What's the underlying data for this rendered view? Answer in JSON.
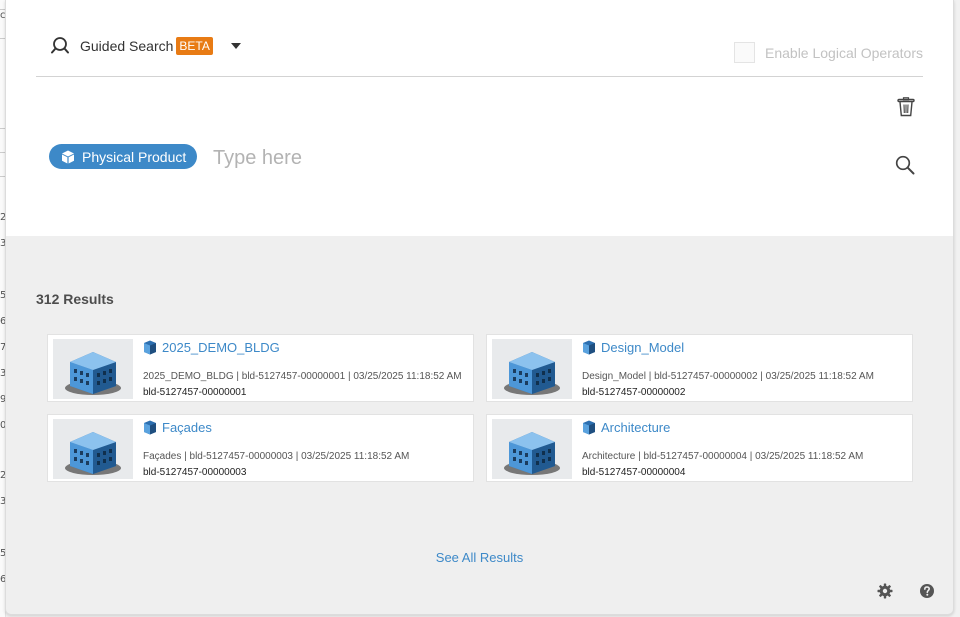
{
  "header": {
    "guided_search_label": "Guided Search",
    "beta_badge": "BETA",
    "logical_operators_label": "Enable Logical Operators"
  },
  "search": {
    "chip_label": "Physical Product",
    "placeholder": "Type here"
  },
  "results": {
    "count_label": "312 Results",
    "items": [
      {
        "title": "2025_DEMO_BLDG",
        "desc": "2025_DEMO_BLDG | bld-5127457-00000001 | 03/25/2025 11:18:52 AM",
        "id": "bld-5127457-00000001"
      },
      {
        "title": "Design_Model",
        "desc": "Design_Model | bld-5127457-00000002 | 03/25/2025 11:18:52 AM",
        "id": "bld-5127457-00000002"
      },
      {
        "title": "Façades",
        "desc": "Façades | bld-5127457-00000003 | 03/25/2025 11:18:52 AM",
        "id": "bld-5127457-00000003"
      },
      {
        "title": "Architecture",
        "desc": "Architecture | bld-5127457-00000004 | 03/25/2025 11:18:52 AM",
        "id": "bld-5127457-00000004"
      }
    ],
    "see_all_label": "See All Results"
  },
  "background_ticks": [
    "c",
    "2",
    "3",
    "5",
    "6",
    "7",
    "3",
    "9",
    "0",
    "2",
    "3",
    "5",
    "6"
  ],
  "colors": {
    "accent": "#3d89c8",
    "beta": "#e87b14"
  },
  "icons": {
    "guided": "guided-search-icon",
    "trash": "trash-icon",
    "search": "search-icon",
    "gear": "gear-icon",
    "help": "help-icon",
    "product": "physical-product-icon"
  }
}
